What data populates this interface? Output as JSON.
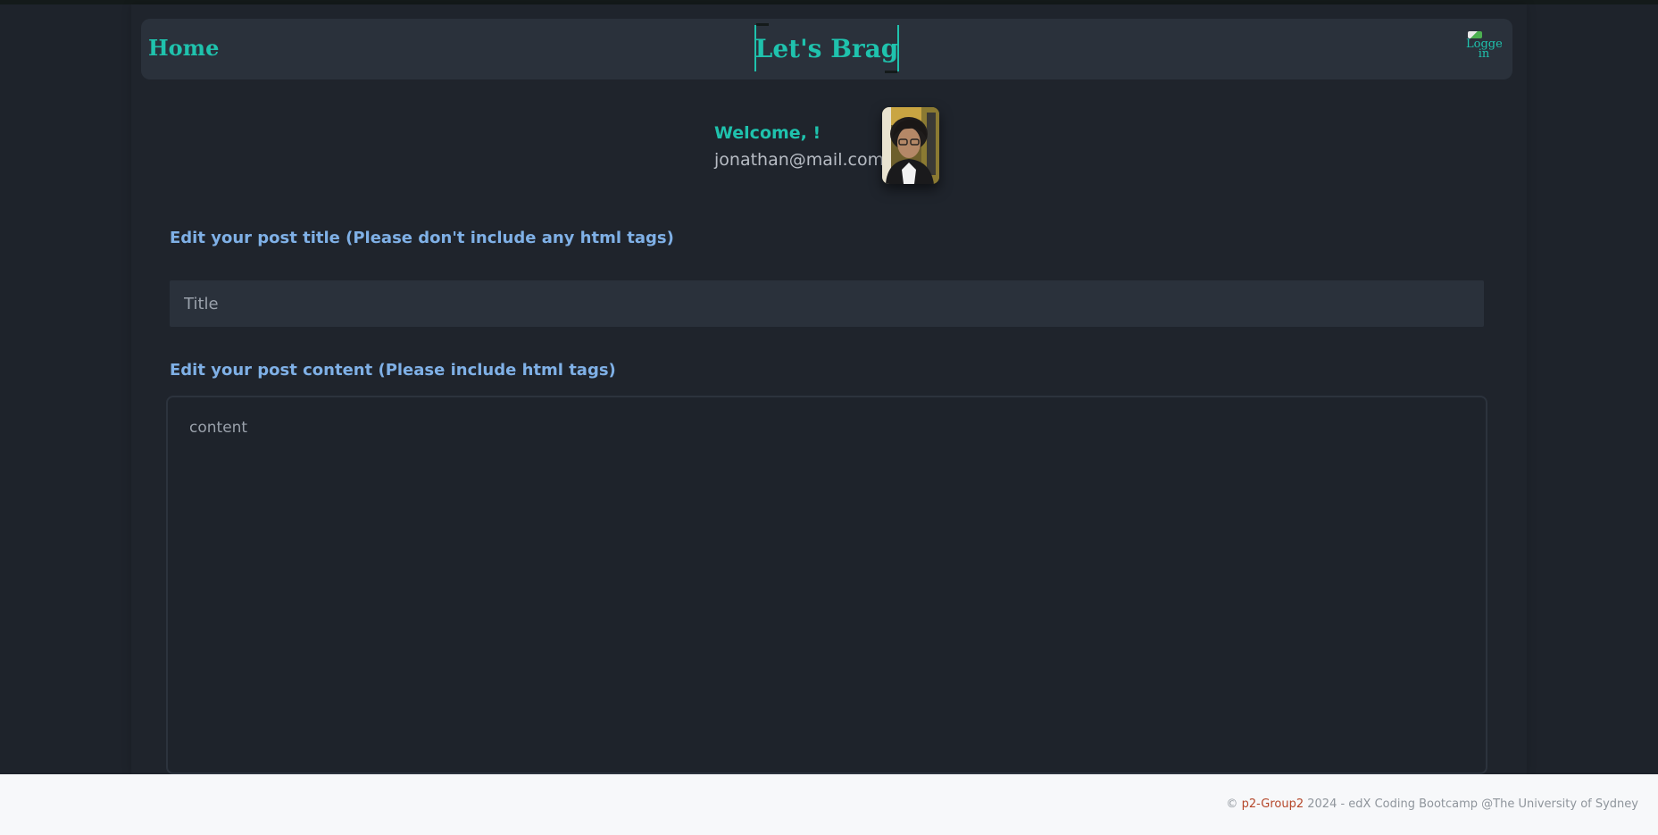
{
  "navbar": {
    "home_label": "Home",
    "brand_title": "Let's Brag",
    "login_alt": "Logged in"
  },
  "profile": {
    "welcome": "Welcome, !",
    "email": "jonathan@mail.com"
  },
  "form": {
    "title_label": "Edit your post title (Please don't include any html tags)",
    "title_placeholder": "Title",
    "content_label": "Edit your post content (Please include html tags)",
    "content_placeholder": "content"
  },
  "footer": {
    "copyright_symbol": "©",
    "group_name": "p2-Group2",
    "rest": "2024 - edX Coding Bootcamp @The University of Sydney"
  },
  "colors": {
    "accent": "#1fc2ad",
    "label": "#7fb0e6",
    "background": "#1e232b",
    "navbar": "#2a313b",
    "footer_link": "#b5472a"
  }
}
